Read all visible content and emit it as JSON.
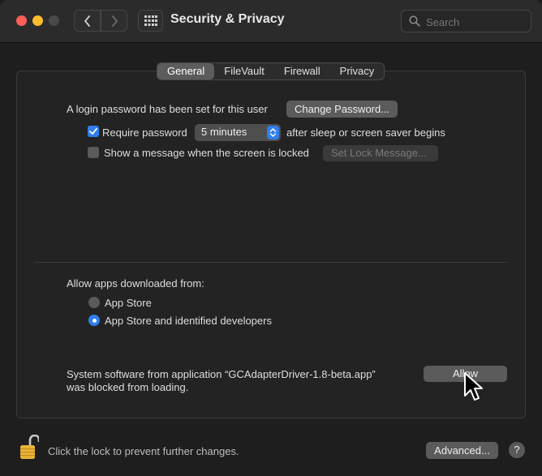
{
  "window": {
    "title": "Security & Privacy",
    "search_placeholder": "Search"
  },
  "tabs": [
    {
      "label": "General",
      "active": true
    },
    {
      "label": "FileVault",
      "active": false
    },
    {
      "label": "Firewall",
      "active": false
    },
    {
      "label": "Privacy",
      "active": false
    }
  ],
  "general": {
    "login_text": "A login password has been set for this user",
    "change_password_label": "Change Password...",
    "require_password": {
      "label": "Require password",
      "checked": true
    },
    "require_interval": "5 minutes",
    "after_text": "after sleep or screen saver begins",
    "show_message": {
      "label": "Show a message when the screen is locked",
      "checked": false
    },
    "set_lock_message_label": "Set Lock Message..."
  },
  "allow_apps": {
    "heading": "Allow apps downloaded from:",
    "options": [
      {
        "label": "App Store",
        "selected": false
      },
      {
        "label": "App Store and identified developers",
        "selected": true
      }
    ]
  },
  "blocked": {
    "line1": "System software from application “GCAdapterDriver-1.8-beta.app”",
    "line2": "was blocked from loading.",
    "allow_label": "Allow"
  },
  "footer": {
    "lock_text": "Click the lock to prevent further changes.",
    "advanced_label": "Advanced...",
    "help_label": "?"
  },
  "colors": {
    "accent": "#2f7ff0",
    "close": "#fe5f57",
    "minimize": "#febc2e"
  }
}
